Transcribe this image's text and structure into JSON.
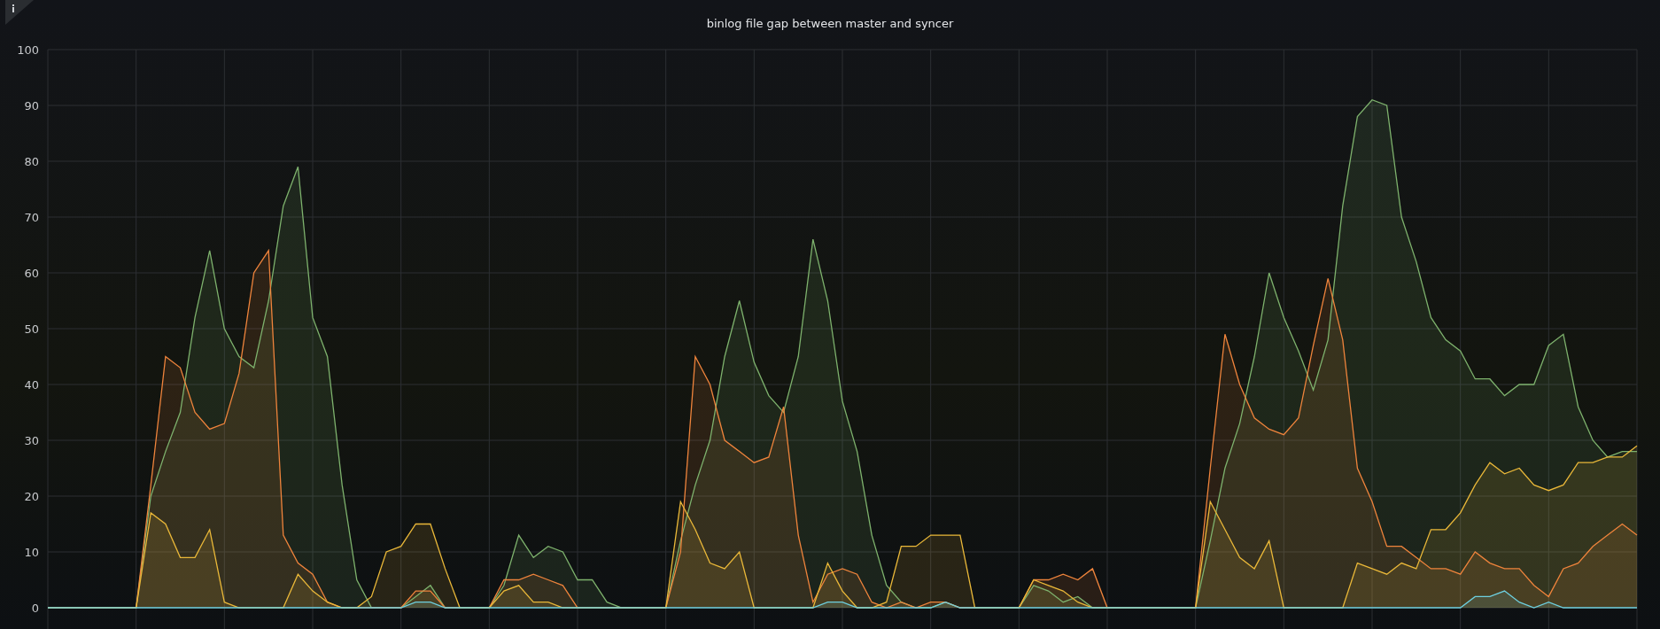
{
  "panel": {
    "title": "binlog file gap between master and syncer",
    "chart_data": {
      "type": "area",
      "grid": true,
      "ylim": [
        0,
        100
      ],
      "yticks": [
        0,
        10,
        20,
        30,
        40,
        50,
        60,
        70,
        80,
        90,
        100
      ],
      "series": [
        {
          "color": "#7eb26d",
          "values": [
            0,
            0,
            0,
            0,
            0,
            0,
            0,
            20,
            28,
            35,
            52,
            64,
            50,
            45,
            43,
            55,
            72,
            79,
            52,
            45,
            22,
            5,
            0,
            0,
            0,
            2,
            4,
            0,
            0,
            0,
            0,
            4,
            13,
            9,
            11,
            10,
            5,
            5,
            1,
            0,
            0,
            0,
            0,
            12,
            22,
            30,
            45,
            55,
            44,
            38,
            35,
            45,
            66,
            55,
            37,
            28,
            13,
            4,
            1,
            0,
            0,
            1,
            0,
            0,
            0,
            0,
            0,
            4,
            3,
            1,
            2,
            0,
            0,
            0,
            0,
            0,
            0,
            0,
            0,
            12,
            25,
            33,
            45,
            60,
            52,
            46,
            39,
            48,
            72,
            88,
            91,
            90,
            70,
            62,
            52,
            48,
            46,
            41,
            41,
            38,
            40,
            40,
            47,
            49,
            36,
            30,
            27,
            28,
            28
          ]
        },
        {
          "color": "#ef843c",
          "values": [
            0,
            0,
            0,
            0,
            0,
            0,
            0,
            22,
            45,
            43,
            35,
            32,
            33,
            42,
            60,
            64,
            13,
            8,
            6,
            1,
            0,
            0,
            0,
            0,
            0,
            3,
            3,
            0,
            0,
            0,
            0,
            5,
            5,
            6,
            5,
            4,
            0,
            0,
            0,
            0,
            0,
            0,
            0,
            10,
            45,
            40,
            30,
            28,
            26,
            27,
            36,
            13,
            1,
            6,
            7,
            6,
            1,
            0,
            1,
            0,
            1,
            1,
            0,
            0,
            0,
            0,
            0,
            5,
            5,
            6,
            5,
            7,
            0,
            0,
            0,
            0,
            0,
            0,
            0,
            25,
            49,
            40,
            34,
            32,
            31,
            34,
            47,
            59,
            48,
            25,
            19,
            11,
            11,
            9,
            7,
            7,
            6,
            10,
            8,
            7,
            7,
            4,
            2,
            7,
            8,
            11,
            13,
            15,
            13
          ]
        },
        {
          "color": "#eab839",
          "values": [
            0,
            0,
            0,
            0,
            0,
            0,
            0,
            17,
            15,
            9,
            9,
            14,
            1,
            0,
            0,
            0,
            0,
            6,
            3,
            1,
            0,
            0,
            2,
            10,
            11,
            15,
            15,
            7,
            0,
            0,
            0,
            3,
            4,
            1,
            1,
            0,
            0,
            0,
            0,
            0,
            0,
            0,
            0,
            19,
            14,
            8,
            7,
            10,
            0,
            0,
            0,
            0,
            0,
            8,
            3,
            0,
            0,
            1,
            11,
            11,
            13,
            13,
            13,
            0,
            0,
            0,
            0,
            5,
            4,
            3,
            1,
            0,
            0,
            0,
            0,
            0,
            0,
            0,
            0,
            19,
            14,
            9,
            7,
            12,
            0,
            0,
            0,
            0,
            0,
            8,
            7,
            6,
            8,
            7,
            14,
            14,
            17,
            22,
            26,
            24,
            25,
            22,
            21,
            22,
            26,
            26,
            27,
            27,
            29
          ]
        },
        {
          "color": "#6ed0e0",
          "values": [
            0,
            0,
            0,
            0,
            0,
            0,
            0,
            0,
            0,
            0,
            0,
            0,
            0,
            0,
            0,
            0,
            0,
            0,
            0,
            0,
            0,
            0,
            0,
            0,
            0,
            1,
            1,
            0,
            0,
            0,
            0,
            0,
            0,
            0,
            0,
            0,
            0,
            0,
            0,
            0,
            0,
            0,
            0,
            0,
            0,
            0,
            0,
            0,
            0,
            0,
            0,
            0,
            0,
            1,
            1,
            0,
            0,
            0,
            0,
            0,
            0,
            1,
            0,
            0,
            0,
            0,
            0,
            0,
            0,
            0,
            0,
            0,
            0,
            0,
            0,
            0,
            0,
            0,
            0,
            0,
            0,
            0,
            0,
            0,
            0,
            0,
            0,
            0,
            0,
            0,
            0,
            0,
            0,
            0,
            0,
            0,
            0,
            2,
            2,
            3,
            1,
            0,
            1,
            0,
            0,
            0,
            0,
            0,
            0
          ]
        }
      ]
    }
  }
}
